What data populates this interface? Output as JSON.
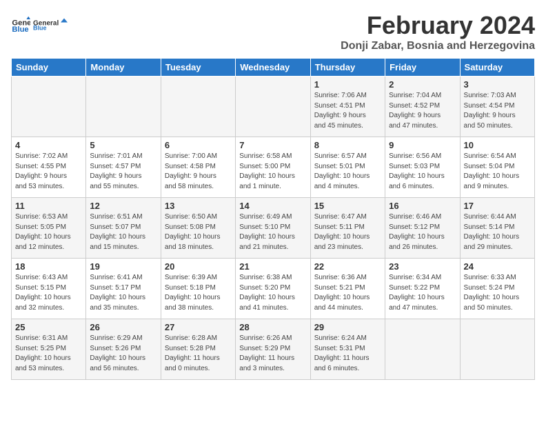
{
  "logo": {
    "text_general": "General",
    "text_blue": "Blue"
  },
  "header": {
    "month_year": "February 2024",
    "location": "Donji Zabar, Bosnia and Herzegovina"
  },
  "weekdays": [
    "Sunday",
    "Monday",
    "Tuesday",
    "Wednesday",
    "Thursday",
    "Friday",
    "Saturday"
  ],
  "weeks": [
    [
      {
        "day": "",
        "info": ""
      },
      {
        "day": "",
        "info": ""
      },
      {
        "day": "",
        "info": ""
      },
      {
        "day": "",
        "info": ""
      },
      {
        "day": "1",
        "info": "Sunrise: 7:06 AM\nSunset: 4:51 PM\nDaylight: 9 hours\nand 45 minutes."
      },
      {
        "day": "2",
        "info": "Sunrise: 7:04 AM\nSunset: 4:52 PM\nDaylight: 9 hours\nand 47 minutes."
      },
      {
        "day": "3",
        "info": "Sunrise: 7:03 AM\nSunset: 4:54 PM\nDaylight: 9 hours\nand 50 minutes."
      }
    ],
    [
      {
        "day": "4",
        "info": "Sunrise: 7:02 AM\nSunset: 4:55 PM\nDaylight: 9 hours\nand 53 minutes."
      },
      {
        "day": "5",
        "info": "Sunrise: 7:01 AM\nSunset: 4:57 PM\nDaylight: 9 hours\nand 55 minutes."
      },
      {
        "day": "6",
        "info": "Sunrise: 7:00 AM\nSunset: 4:58 PM\nDaylight: 9 hours\nand 58 minutes."
      },
      {
        "day": "7",
        "info": "Sunrise: 6:58 AM\nSunset: 5:00 PM\nDaylight: 10 hours\nand 1 minute."
      },
      {
        "day": "8",
        "info": "Sunrise: 6:57 AM\nSunset: 5:01 PM\nDaylight: 10 hours\nand 4 minutes."
      },
      {
        "day": "9",
        "info": "Sunrise: 6:56 AM\nSunset: 5:03 PM\nDaylight: 10 hours\nand 6 minutes."
      },
      {
        "day": "10",
        "info": "Sunrise: 6:54 AM\nSunset: 5:04 PM\nDaylight: 10 hours\nand 9 minutes."
      }
    ],
    [
      {
        "day": "11",
        "info": "Sunrise: 6:53 AM\nSunset: 5:05 PM\nDaylight: 10 hours\nand 12 minutes."
      },
      {
        "day": "12",
        "info": "Sunrise: 6:51 AM\nSunset: 5:07 PM\nDaylight: 10 hours\nand 15 minutes."
      },
      {
        "day": "13",
        "info": "Sunrise: 6:50 AM\nSunset: 5:08 PM\nDaylight: 10 hours\nand 18 minutes."
      },
      {
        "day": "14",
        "info": "Sunrise: 6:49 AM\nSunset: 5:10 PM\nDaylight: 10 hours\nand 21 minutes."
      },
      {
        "day": "15",
        "info": "Sunrise: 6:47 AM\nSunset: 5:11 PM\nDaylight: 10 hours\nand 23 minutes."
      },
      {
        "day": "16",
        "info": "Sunrise: 6:46 AM\nSunset: 5:12 PM\nDaylight: 10 hours\nand 26 minutes."
      },
      {
        "day": "17",
        "info": "Sunrise: 6:44 AM\nSunset: 5:14 PM\nDaylight: 10 hours\nand 29 minutes."
      }
    ],
    [
      {
        "day": "18",
        "info": "Sunrise: 6:43 AM\nSunset: 5:15 PM\nDaylight: 10 hours\nand 32 minutes."
      },
      {
        "day": "19",
        "info": "Sunrise: 6:41 AM\nSunset: 5:17 PM\nDaylight: 10 hours\nand 35 minutes."
      },
      {
        "day": "20",
        "info": "Sunrise: 6:39 AM\nSunset: 5:18 PM\nDaylight: 10 hours\nand 38 minutes."
      },
      {
        "day": "21",
        "info": "Sunrise: 6:38 AM\nSunset: 5:20 PM\nDaylight: 10 hours\nand 41 minutes."
      },
      {
        "day": "22",
        "info": "Sunrise: 6:36 AM\nSunset: 5:21 PM\nDaylight: 10 hours\nand 44 minutes."
      },
      {
        "day": "23",
        "info": "Sunrise: 6:34 AM\nSunset: 5:22 PM\nDaylight: 10 hours\nand 47 minutes."
      },
      {
        "day": "24",
        "info": "Sunrise: 6:33 AM\nSunset: 5:24 PM\nDaylight: 10 hours\nand 50 minutes."
      }
    ],
    [
      {
        "day": "25",
        "info": "Sunrise: 6:31 AM\nSunset: 5:25 PM\nDaylight: 10 hours\nand 53 minutes."
      },
      {
        "day": "26",
        "info": "Sunrise: 6:29 AM\nSunset: 5:26 PM\nDaylight: 10 hours\nand 56 minutes."
      },
      {
        "day": "27",
        "info": "Sunrise: 6:28 AM\nSunset: 5:28 PM\nDaylight: 11 hours\nand 0 minutes."
      },
      {
        "day": "28",
        "info": "Sunrise: 6:26 AM\nSunset: 5:29 PM\nDaylight: 11 hours\nand 3 minutes."
      },
      {
        "day": "29",
        "info": "Sunrise: 6:24 AM\nSunset: 5:31 PM\nDaylight: 11 hours\nand 6 minutes."
      },
      {
        "day": "",
        "info": ""
      },
      {
        "day": "",
        "info": ""
      }
    ]
  ]
}
